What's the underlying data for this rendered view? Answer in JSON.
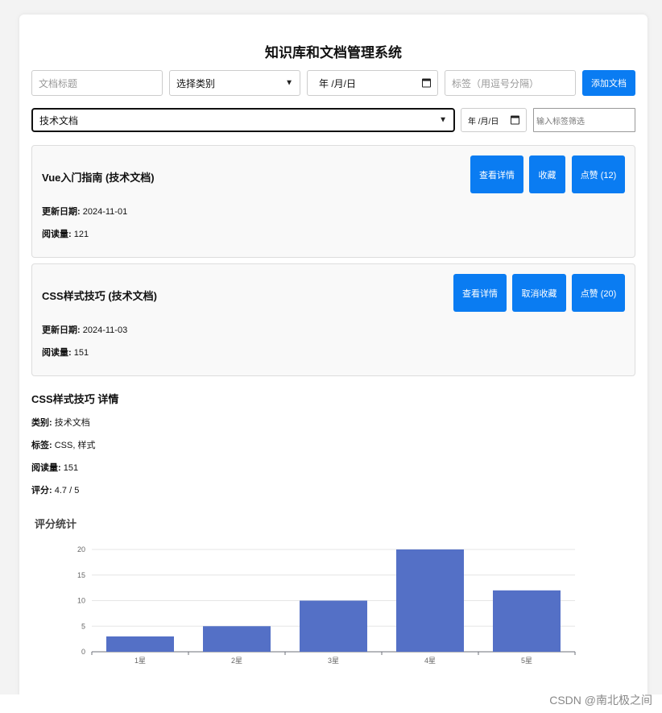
{
  "app": {
    "title": "知识库和文档管理系统"
  },
  "form": {
    "title_placeholder": "文档标题",
    "category_select": "选择类别",
    "date_placeholder": "年 /月/日",
    "tags_placeholder": "标签（用逗号分隔）",
    "add_button": "添加文档"
  },
  "filters": {
    "category": "技术文档",
    "date_placeholder": "年 /月/日",
    "tag_placeholder": "输入标签筛选"
  },
  "documents": [
    {
      "title": "Vue入门指南 (技术文档)",
      "updated_label": "更新日期:",
      "updated": "2024-11-01",
      "views_label": "阅读量:",
      "views": "121",
      "view_button": "查看详情",
      "fav_button": "收藏",
      "like_button": "点赞 (12)"
    },
    {
      "title": "CSS样式技巧 (技术文档)",
      "updated_label": "更新日期:",
      "updated": "2024-11-03",
      "views_label": "阅读量:",
      "views": "151",
      "view_button": "查看详情",
      "fav_button": "取消收藏",
      "like_button": "点赞 (20)"
    }
  ],
  "detail": {
    "title": "CSS样式技巧 详情",
    "category_label": "类别:",
    "category": "技术文档",
    "tags_label": "标签:",
    "tags": "CSS, 样式",
    "views_label": "阅读量:",
    "views": "151",
    "rating_label": "评分:",
    "rating": "4.7 / 5"
  },
  "chart_section": {
    "title": "评分统计"
  },
  "chart_data": {
    "type": "bar",
    "categories": [
      "1星",
      "2星",
      "3星",
      "4星",
      "5星"
    ],
    "values": [
      3,
      5,
      10,
      20,
      12
    ],
    "ylim": [
      0,
      20
    ],
    "yticks": [
      0,
      5,
      10,
      15,
      20
    ],
    "grid": true,
    "bar_color": "#5470c6"
  },
  "watermark": "CSDN @南北极之间",
  "colors": {
    "primary": "#0a7cf2"
  }
}
